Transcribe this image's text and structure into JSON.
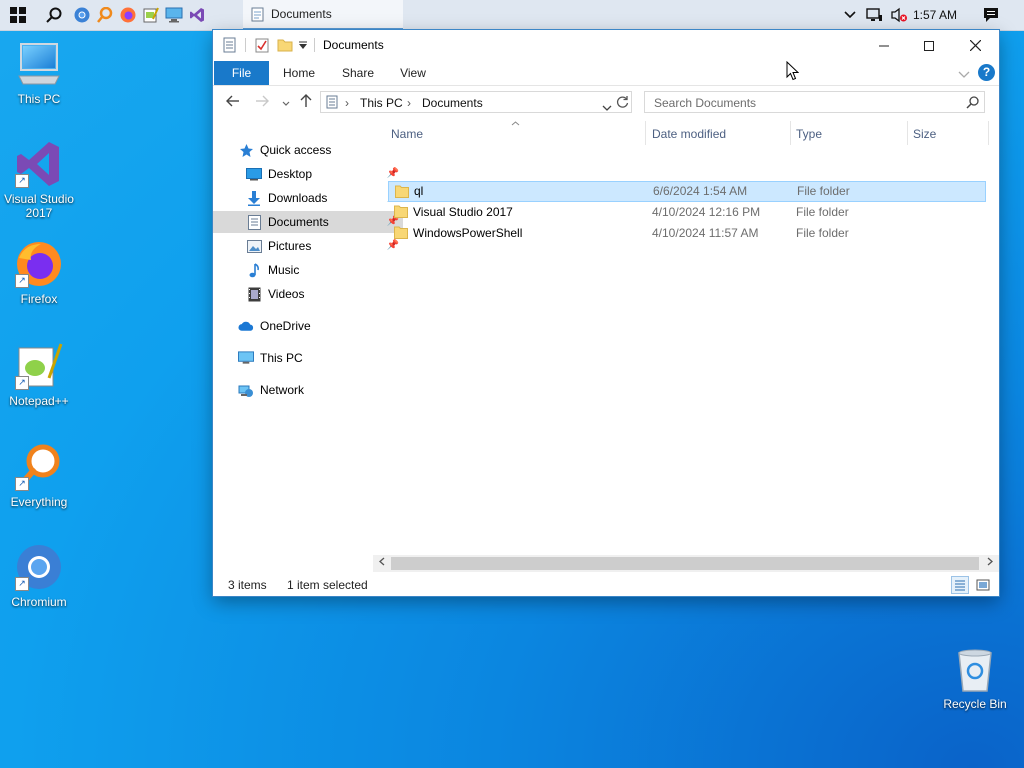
{
  "taskbar": {
    "icons": [
      "windows-start-icon",
      "search-icon",
      "chromium-icon",
      "everything-icon",
      "firefox-icon",
      "notepadpp-icon",
      "this-pc-icon",
      "visual-studio-icon"
    ],
    "active_task": "Documents",
    "time": "1:57 AM"
  },
  "desktop": {
    "icons": [
      {
        "id": "this-pc",
        "label": "This PC"
      },
      {
        "id": "visual-studio",
        "label_l1": "Visual Studio",
        "label_l2": "2017"
      },
      {
        "id": "firefox",
        "label": "Firefox"
      },
      {
        "id": "notepadpp",
        "label": "Notepad++"
      },
      {
        "id": "everything",
        "label": "Everything"
      },
      {
        "id": "chromium",
        "label": "Chromium"
      },
      {
        "id": "recycle-bin",
        "label": "Recycle Bin"
      }
    ]
  },
  "window": {
    "title": "Documents",
    "ribbon_tabs": [
      "File",
      "Home",
      "Share",
      "View"
    ],
    "breadcrumb": [
      "This PC",
      "Documents"
    ],
    "search_placeholder": "Search Documents",
    "nav": [
      {
        "label": "Quick access"
      },
      {
        "label": "Desktop",
        "pinned": true
      },
      {
        "label": "Downloads",
        "pinned": true
      },
      {
        "label": "Documents",
        "pinned": true,
        "selected": true
      },
      {
        "label": "Pictures",
        "pinned": true
      },
      {
        "label": "Music"
      },
      {
        "label": "Videos"
      },
      {
        "label": "OneDrive"
      },
      {
        "label": "This PC"
      },
      {
        "label": "Network"
      }
    ],
    "columns": [
      "Name",
      "Date modified",
      "Type",
      "Size"
    ],
    "files": [
      {
        "name": "ql",
        "date": "6/6/2024 1:54 AM",
        "type": "File folder",
        "selected": true
      },
      {
        "name": "Visual Studio 2017",
        "date": "4/10/2024 12:16 PM",
        "type": "File folder"
      },
      {
        "name": "WindowsPowerShell",
        "date": "4/10/2024 11:57 AM",
        "type": "File folder"
      }
    ],
    "status": {
      "count": "3 items",
      "selection": "1 item selected"
    }
  },
  "colors": {
    "accent": "#1979ca",
    "selection": "#cce8ff",
    "folder": "#f8d775"
  }
}
